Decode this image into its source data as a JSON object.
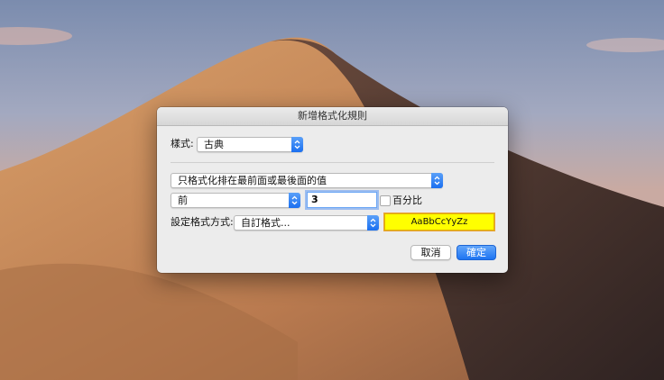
{
  "dialog": {
    "title": "新增格式化規則",
    "style_label": "樣式:",
    "style_value": "古典",
    "rule_type_value": "只格式化排在最前面或最後面的值",
    "rank_value": "前",
    "rank_count": "3",
    "percent_label": "百分比",
    "percent_checked": false,
    "format_with_label": "設定格式方式:",
    "format_with_value": "自訂格式...",
    "preview_text": "AaBbCcYyZz",
    "preview_fill": "#ffff00",
    "cancel_label": "取消",
    "ok_label": "確定",
    "accent_color": "#1e74f2"
  }
}
